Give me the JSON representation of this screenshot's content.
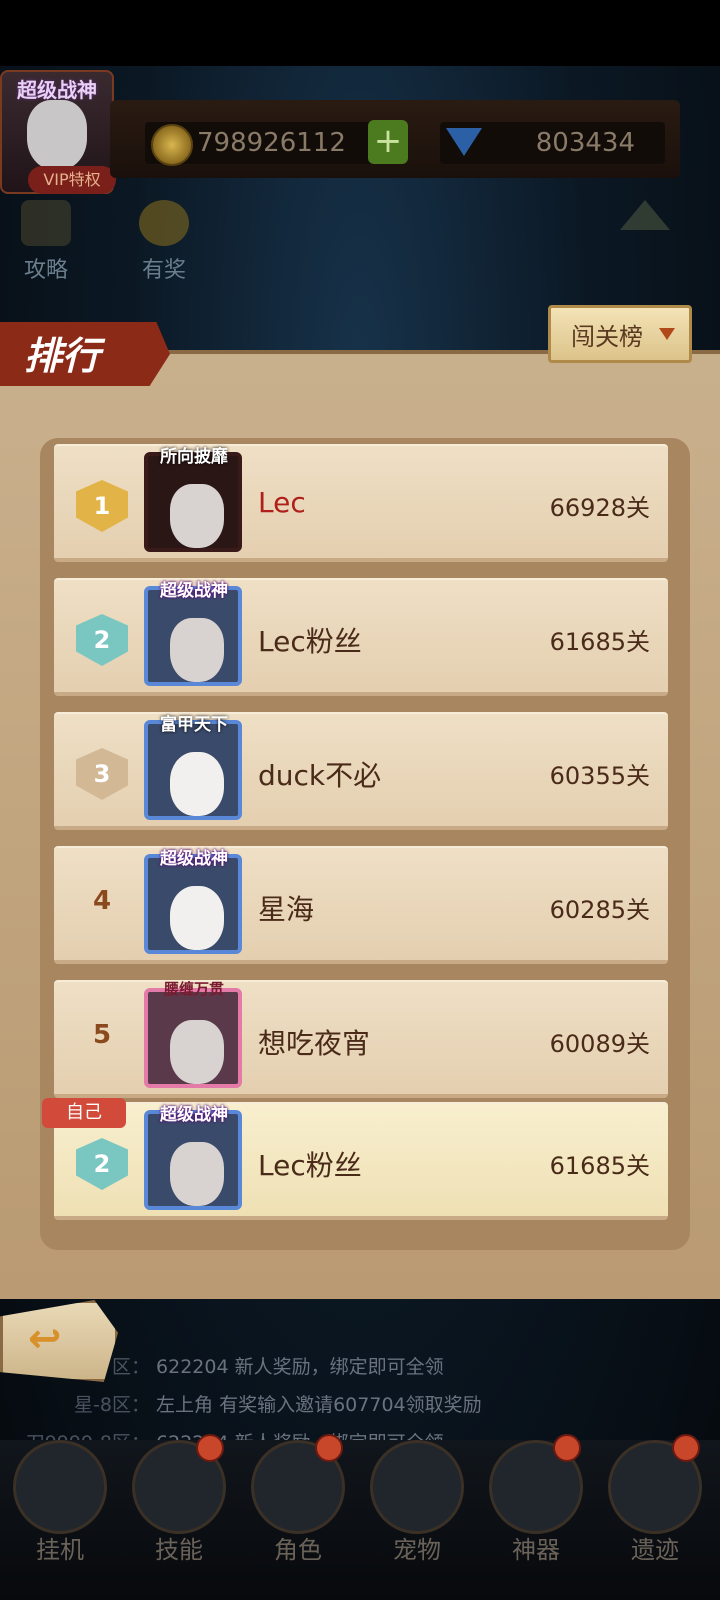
{
  "player": {
    "avatar_title": "超级战神",
    "vip_label": "VIP特权"
  },
  "resources": {
    "coins": "798926112",
    "plus_label": "+",
    "gems": "803434"
  },
  "shortcuts": [
    {
      "label": "攻略",
      "icon": "guide-icon"
    },
    {
      "label": "有奖",
      "icon": "reward-star-icon"
    }
  ],
  "panel": {
    "title": "排行",
    "board_selector": "闯关榜"
  },
  "ranking": [
    {
      "rank": "1",
      "frame_title": "所向披靡",
      "name": "Lec",
      "score": "66928关"
    },
    {
      "rank": "2",
      "frame_title": "超级战神",
      "name": "Lec粉丝",
      "score": "61685关"
    },
    {
      "rank": "3",
      "frame_title": "富甲天下",
      "name": "duck不必",
      "score": "60355关"
    },
    {
      "rank": "4",
      "frame_title": "超级战神",
      "name": "星海",
      "score": "60285关"
    },
    {
      "rank": "5",
      "frame_title": "腰缠万贯",
      "name": "想吃夜宵",
      "score": "60089关"
    }
  ],
  "self_row": {
    "tag": "自己",
    "rank": "2",
    "frame_title": "超级战神",
    "name": "Lec粉丝",
    "score": "61685关"
  },
  "chat": [
    {
      "source": "区：",
      "text": "622204  新人奖励，绑定即可全领"
    },
    {
      "source": "星-8区：",
      "text": "左上角 有奖输入邀请607704领取奖励"
    },
    {
      "source": "一刀9999-8区：",
      "text": "622204  新人奖励，绑定即可全领"
    }
  ],
  "bottom_nav": [
    {
      "label": "挂机",
      "badge": false
    },
    {
      "label": "技能",
      "badge": true
    },
    {
      "label": "角色",
      "badge": true
    },
    {
      "label": "宠物",
      "badge": false
    },
    {
      "label": "神器",
      "badge": true
    },
    {
      "label": "遗迹",
      "badge": true
    }
  ]
}
